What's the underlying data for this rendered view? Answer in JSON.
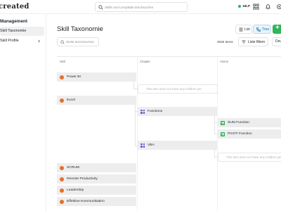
{
  "topbar": {
    "logo_text": "created",
    "search_placeholder": "Skills und Lernpfade durchsuchen",
    "xlp_value": "18LP",
    "icons": [
      "search-icon",
      "grid-icon",
      "bell-icon",
      "settings-icon"
    ]
  },
  "sidebar": {
    "heading": "Management",
    "items": [
      {
        "label": "Skill Taxonomie",
        "active": true
      },
      {
        "label": "Skill Profile",
        "active": false
      }
    ]
  },
  "main": {
    "title": "Skill Taxonomie",
    "view": {
      "list_label": "List",
      "tree_label": "Tree",
      "active": "Tree"
    },
    "add_label": "+",
    "skill_search_placeholder": "Skills durchsuchen",
    "item_count": "2936 Items",
    "filter_label": "Liste filtern",
    "language_label": "Deu"
  },
  "table": {
    "columns": [
      "Skill",
      "Chapter",
      "Atoms"
    ],
    "empty_text": "This item does not have any children yet",
    "skills": [
      "Power BI",
      "Excel",
      "SCRUM",
      "Remote Productivity",
      "Leadership",
      "Effektive Kommunikation"
    ],
    "chapters": [
      "Functions",
      "VBA"
    ],
    "atoms": [
      "SUM Function",
      "PIVOT Function"
    ]
  },
  "colors": {
    "accent_green": "#2fb457",
    "skill_orange": "#e2702f",
    "chapter_purple": "#7a55d8",
    "tree_active_blue": "#1d6fa8"
  }
}
